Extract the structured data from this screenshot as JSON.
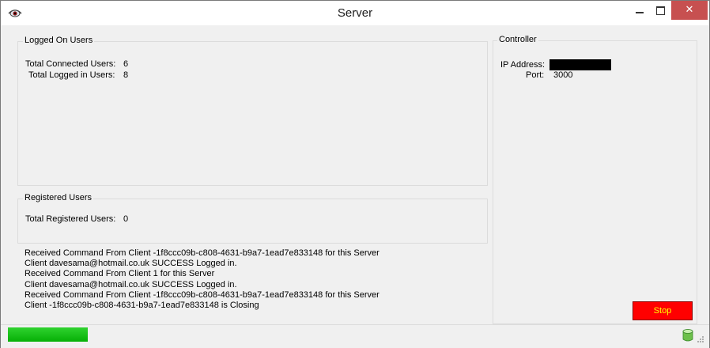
{
  "window": {
    "title": "Server",
    "close_glyph": "✕"
  },
  "icons": {
    "app": "eye-app-icon",
    "database": "database-icon",
    "grip": "resize-grip-icon"
  },
  "logged_on_users": {
    "legend": "Logged On Users",
    "connected_label": "Total Connected Users:",
    "connected_value": "6",
    "logged_in_label": "Total Logged in Users:",
    "logged_in_value": "8"
  },
  "registered_users": {
    "legend": "Registered Users",
    "total_label": "Total Registered Users:",
    "total_value": "0"
  },
  "log": [
    "Received Command From Client -1f8ccc09b-c808-4631-b9a7-1ead7e833148 for this Server",
    "Client davesama@hotmail.co.uk SUCCESS Logged in.",
    "Received Command From Client 1 for this Server",
    "Client davesama@hotmail.co.uk SUCCESS Logged in.",
    "Received Command From Client -1f8ccc09b-c808-4631-b9a7-1ead7e833148 for this Server",
    "Client -1f8ccc09b-c808-4631-b9a7-1ead7e833148 is Closing"
  ],
  "controller": {
    "legend": "Controller",
    "ip_label": "IP Address:",
    "port_label": "Port:",
    "port_value": "3000",
    "stop_label": "Stop"
  },
  "colors": {
    "stop_bg": "#ff0000",
    "stop_text": "#ffff00",
    "progress": "#06b006",
    "close_bg": "#c75050"
  },
  "status": {
    "progress_fraction": 1.0
  }
}
